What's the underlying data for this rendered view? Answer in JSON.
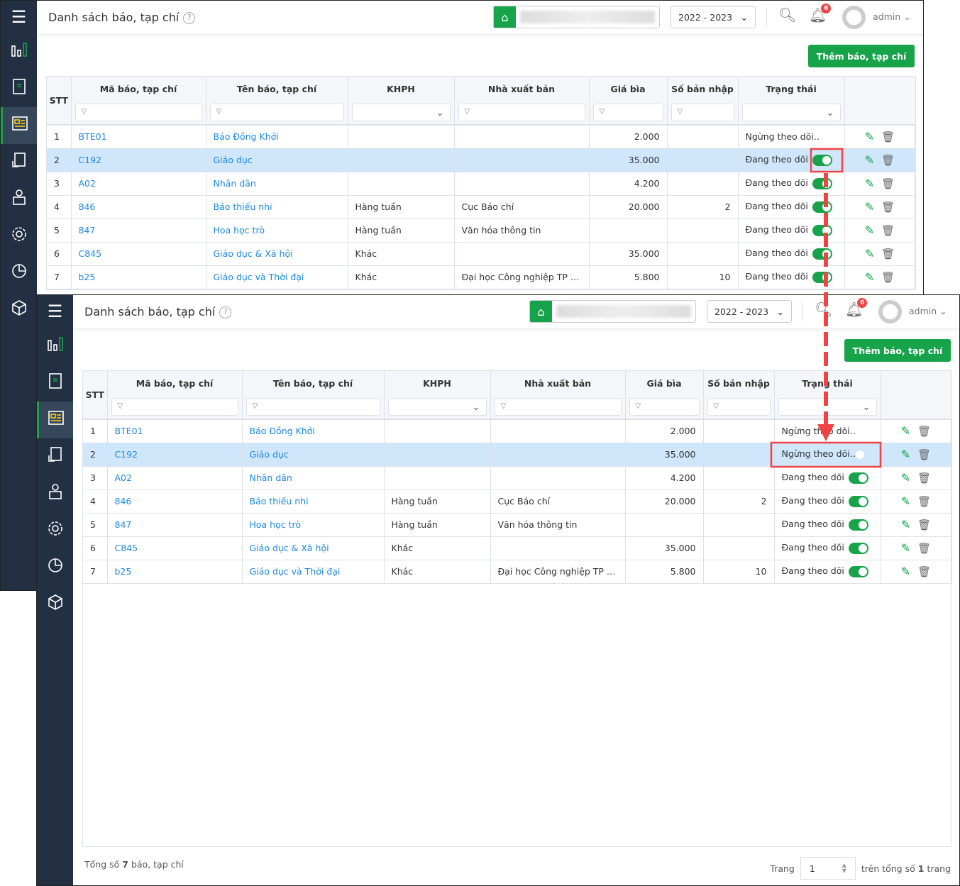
{
  "sidebar": {
    "items": [
      "menu-icon",
      "dashboard-icon",
      "book-icon",
      "newspaper-icon",
      "document-icon",
      "reader-icon",
      "gear-icon",
      "chart-pie-icon",
      "box-icon"
    ],
    "active": 3
  },
  "header": {
    "title": "Danh sách báo, tạp chí",
    "help": "?",
    "year": "2022 - 2023",
    "notifications": "6",
    "user": "admin"
  },
  "toolbar": {
    "add_label": "Thêm báo, tạp chí"
  },
  "columns": {
    "stt": "STT",
    "code": "Mã báo, tạp chí",
    "name": "Tên báo, tạp chí",
    "khph": "KHPH",
    "publisher": "Nhà xuất bản",
    "price": "Giá bìa",
    "qty": "Số bản nhập",
    "status": "Trạng thái"
  },
  "filter_icon": "▽",
  "screens": [
    {
      "rows": [
        {
          "stt": "1",
          "code": "BTE01",
          "name": "Báo Đồng Khởi",
          "khph": "",
          "publisher": "",
          "price": "2.000",
          "qty": "",
          "status": "Ngừng theo dõi",
          "on": false
        },
        {
          "stt": "2",
          "code": "C192",
          "name": "Giáo dục",
          "khph": "",
          "publisher": "",
          "price": "35.000",
          "qty": "",
          "status": "Đang theo dõi",
          "on": true,
          "selected": true
        },
        {
          "stt": "3",
          "code": "A02",
          "name": "Nhân dân",
          "khph": "",
          "publisher": "",
          "price": "4.200",
          "qty": "",
          "status": "Đang theo dõi",
          "on": true
        },
        {
          "stt": "4",
          "code": "846",
          "name": "Báo thiếu nhi",
          "khph": "Hàng tuần",
          "publisher": "Cục Báo chí",
          "price": "20.000",
          "qty": "2",
          "status": "Đang theo dõi",
          "on": true
        },
        {
          "stt": "5",
          "code": "847",
          "name": "Hoa học trò",
          "khph": "Hàng tuần",
          "publisher": "Văn hóa thông tin",
          "price": "",
          "qty": "",
          "status": "Đang theo dõi",
          "on": true
        },
        {
          "stt": "6",
          "code": "C845",
          "name": "Giáo dục & Xã hội",
          "khph": "Khác",
          "publisher": "",
          "price": "35.000",
          "qty": "",
          "status": "Đang theo dõi",
          "on": true
        },
        {
          "stt": "7",
          "code": "b25",
          "name": "Giáo dục và Thời đại",
          "khph": "Khác",
          "publisher": "Đại học Công nghiệp TP H...",
          "price": "5.800",
          "qty": "10",
          "status": "Đang theo dõi",
          "on": true
        }
      ]
    },
    {
      "rows": [
        {
          "stt": "1",
          "code": "BTE01",
          "name": "Báo Đồng Khởi",
          "khph": "",
          "publisher": "",
          "price": "2.000",
          "qty": "",
          "status": "Ngừng theo dõi",
          "on": false
        },
        {
          "stt": "2",
          "code": "C192",
          "name": "Giáo dục",
          "khph": "",
          "publisher": "",
          "price": "35.000",
          "qty": "",
          "status": "Ngừng theo dõi",
          "on": false,
          "selected": true
        },
        {
          "stt": "3",
          "code": "A02",
          "name": "Nhân dân",
          "khph": "",
          "publisher": "",
          "price": "4.200",
          "qty": "",
          "status": "Đang theo dõi",
          "on": true
        },
        {
          "stt": "4",
          "code": "846",
          "name": "Báo thiếu nhi",
          "khph": "Hàng tuần",
          "publisher": "Cục Báo chí",
          "price": "20.000",
          "qty": "2",
          "status": "Đang theo dõi",
          "on": true
        },
        {
          "stt": "5",
          "code": "847",
          "name": "Hoa học trò",
          "khph": "Hàng tuần",
          "publisher": "Văn hóa thông tin",
          "price": "",
          "qty": "",
          "status": "Đang theo dõi",
          "on": true
        },
        {
          "stt": "6",
          "code": "C845",
          "name": "Giáo dục & Xã hội",
          "khph": "Khác",
          "publisher": "",
          "price": "35.000",
          "qty": "",
          "status": "Đang theo dõi",
          "on": true
        },
        {
          "stt": "7",
          "code": "b25",
          "name": "Giáo dục và Thời đại",
          "khph": "Khác",
          "publisher": "Đại học Công nghiệp TP H...",
          "price": "5.800",
          "qty": "10",
          "status": "Đang theo dõi",
          "on": true
        }
      ]
    }
  ],
  "footer": {
    "total_prefix": "Tổng số",
    "total": "7",
    "total_suffix": "báo, tạp chí",
    "page_label": "Trang",
    "page": "1",
    "of_prefix": "trên tổng số",
    "pages": "1",
    "of_suffix": "trang"
  },
  "colors": {
    "accent": "#16a34a",
    "sidebar": "#233044",
    "link": "#1e88e5",
    "highlight": "#ef4444",
    "selected_row": "#cfe6fb"
  }
}
